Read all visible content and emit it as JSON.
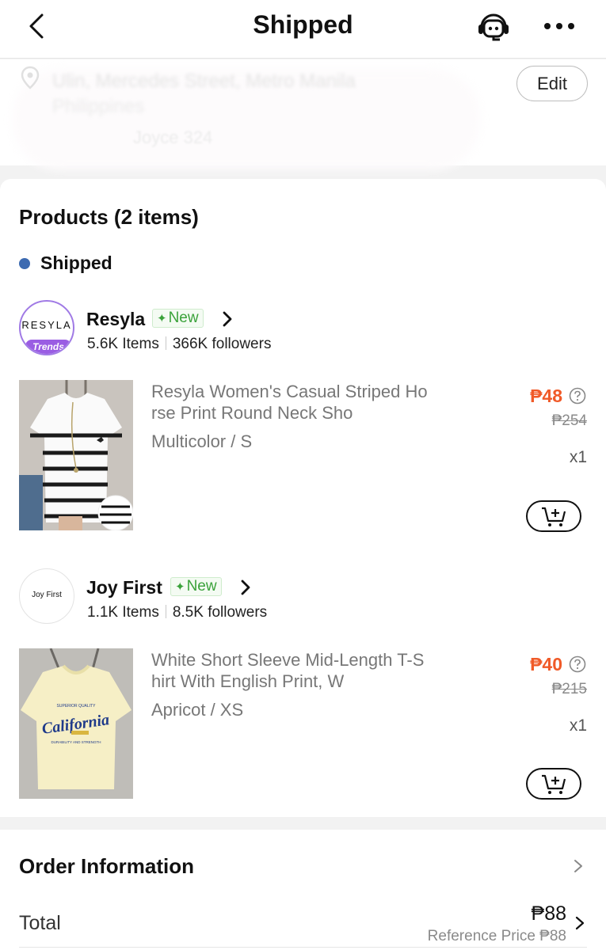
{
  "header": {
    "title": "Shipped",
    "back_icon": "chevron-left-icon",
    "support_icon": "customer-service-robot-icon",
    "more_icon": "more-horizontal-icon"
  },
  "address": {
    "line1": "Ulin, Mercedes Street, Metro Manila",
    "line2": "Philippines",
    "recipient": "Joyce 324",
    "edit_label": "Edit"
  },
  "products": {
    "title": "Products (2 items)",
    "status": "Shipped",
    "status_color": "#3c6ab1",
    "price_color": "#f05a28",
    "stores": [
      {
        "logo_text": "RESYLA",
        "logo_tag": "Trends",
        "name": "Resyla",
        "badge": "New",
        "items": "5.6K Items",
        "followers": "366K followers",
        "product": {
          "name": "Resyla Women's Casual Striped Horse Print Round Neck Sho",
          "variant": "Multicolor / S",
          "price": "₱48",
          "original_price": "₱254",
          "quantity": "x1"
        }
      },
      {
        "logo_text": "Joy First",
        "name": "Joy First",
        "badge": "New",
        "items": "1.1K Items",
        "followers": "8.5K followers",
        "product": {
          "name": "White Short Sleeve Mid-Length T-Shirt With English Print, W",
          "variant": "Apricot / XS",
          "price": "₱40",
          "original_price": "₱215",
          "quantity": "x1",
          "print_text": "California"
        }
      }
    ]
  },
  "order": {
    "title": "Order Information",
    "total_label": "Total",
    "total_value": "₱88",
    "reference_price": "Reference Price ₱88"
  }
}
